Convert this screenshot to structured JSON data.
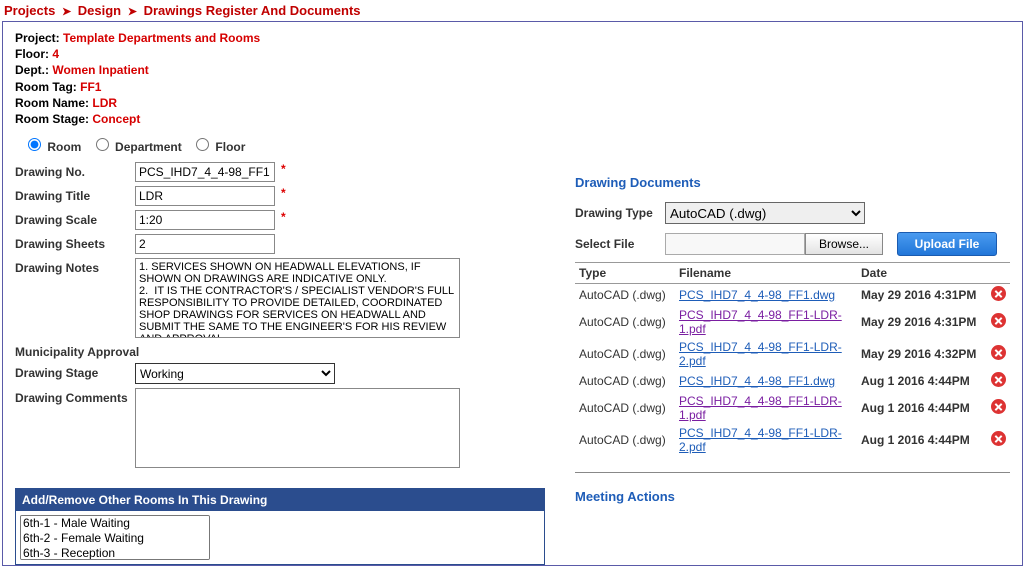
{
  "breadcrumb": {
    "p1": "Projects",
    "p2": "Design",
    "p3": "Drawings Register And Documents"
  },
  "meta": {
    "project_l": "Project:",
    "project_v": "Template Departments and Rooms",
    "floor_l": "Floor:",
    "floor_v": "4",
    "dept_l": "Dept.:",
    "dept_v": "Women Inpatient",
    "roomtag_l": "Room Tag:",
    "roomtag_v": "FF1",
    "roomname_l": "Room Name:",
    "roomname_v": "LDR",
    "stage_l": "Room Stage:",
    "stage_v": "Concept"
  },
  "radio": {
    "room": "Room",
    "dept": "Department",
    "floor": "Floor"
  },
  "form": {
    "no_l": "Drawing No.",
    "no_v": "PCS_IHD7_4_4-98_FF1",
    "title_l": "Drawing Title",
    "title_v": "LDR",
    "scale_l": "Drawing Scale",
    "scale_v": "1:20",
    "sheets_l": "Drawing Sheets",
    "sheets_v": "2",
    "notes_l": "Drawing Notes",
    "notes_v": "1. SERVICES SHOWN ON HEADWALL ELEVATIONS, IF SHOWN ON DRAWINGS ARE INDICATIVE ONLY.\n2.  IT IS THE CONTRACTOR'S / SPECIALIST VENDOR'S FULL RESPONSIBILITY TO PROVIDE DETAILED, COORDINATED SHOP DRAWINGS FOR SERVICES ON HEADWALL AND SUBMIT THE SAME TO THE ENGINEER'S FOR HIS REVIEW AND APPROVAL.",
    "muni_l": "Municipality Approval",
    "dstage_l": "Drawing Stage",
    "dstage_v": "Working",
    "comments_l": "Drawing Comments"
  },
  "doc_section": "Drawing Documents",
  "doc_type_l": "Drawing Type",
  "doc_type_v": "AutoCAD (.dwg)",
  "sel_file_l": "Select File",
  "browse": "Browse...",
  "upload": "Upload File",
  "th": {
    "type": "Type",
    "fn": "Filename",
    "date": "Date"
  },
  "type_dwg": "AutoCAD (.dwg)",
  "rows": {
    "r0": {
      "fn": "PCS_IHD7_4_4-98_FF1.dwg",
      "date": "May 29 2016 4:31PM",
      "cls": "link-blue"
    },
    "r1": {
      "fn": "PCS_IHD7_4_4-98_FF1-LDR-1.pdf",
      "date": "May 29 2016 4:31PM",
      "cls": "link-purple"
    },
    "r2": {
      "fn": "PCS_IHD7_4_4-98_FF1-LDR-2.pdf",
      "date": "May 29 2016 4:32PM",
      "cls": "link-blue"
    },
    "r3": {
      "fn": "PCS_IHD7_4_4-98_FF1.dwg",
      "date": "Aug 1 2016 4:44PM",
      "cls": "link-blue"
    },
    "r4": {
      "fn": "PCS_IHD7_4_4-98_FF1-LDR-1.pdf",
      "date": "Aug 1 2016 4:44PM",
      "cls": "link-purple"
    },
    "r5": {
      "fn": "PCS_IHD7_4_4-98_FF1-LDR-2.pdf",
      "date": "Aug 1 2016 4:44PM",
      "cls": "link-blue"
    }
  },
  "meeting": "Meeting Actions",
  "addremove": {
    "title": "Add/Remove Other Rooms In This Drawing",
    "opt0": "6th-1 - Male Waiting",
    "opt1": "6th-2 - Female Waiting",
    "opt2": "6th-3 - Reception"
  }
}
